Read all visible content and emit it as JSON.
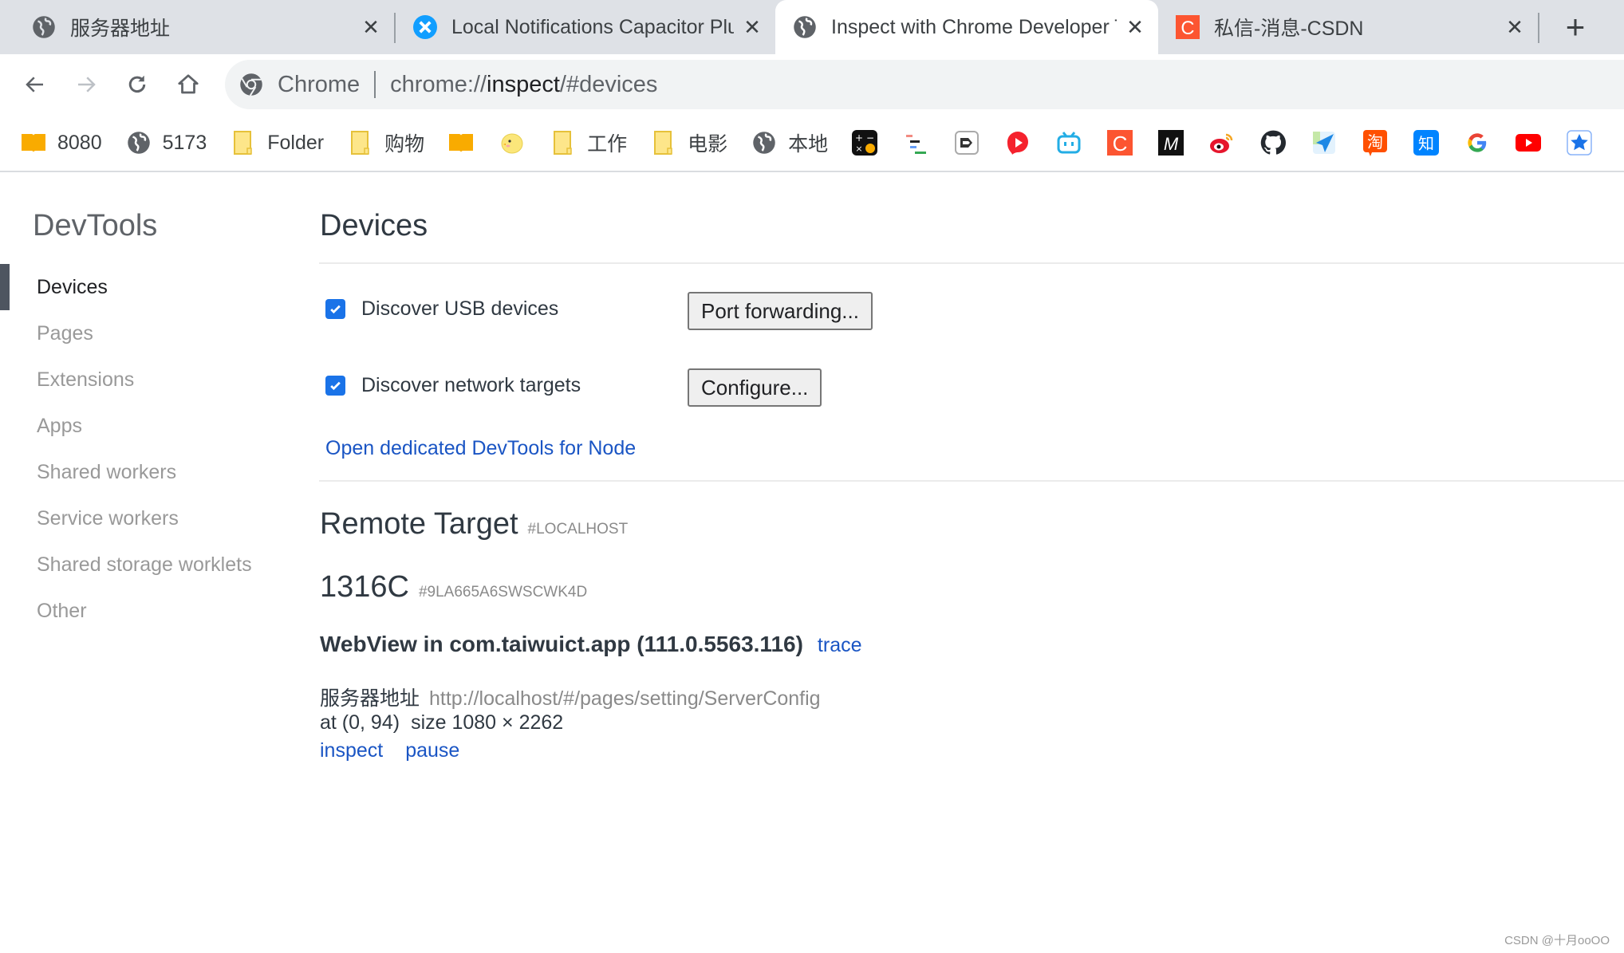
{
  "browser": {
    "tabs": [
      {
        "title": "服务器地址",
        "icon": "globe-icon",
        "active": false
      },
      {
        "title": "Local Notifications Capacitor Plugin API",
        "icon": "capacitor-icon",
        "active": false
      },
      {
        "title": "Inspect with Chrome Developer Tools",
        "icon": "globe-icon",
        "active": true
      },
      {
        "title": "私信-消息-CSDN",
        "icon": "csdn-icon",
        "active": false
      }
    ],
    "new_tab_label": "+",
    "close_label": "✕",
    "omnibox": {
      "chip": "Chrome",
      "url_prefix": "chrome://",
      "url_host": "inspect",
      "url_suffix": "/#devices"
    },
    "bookmarks": [
      {
        "label": "8080",
        "icon": "book-icon"
      },
      {
        "label": "5173",
        "icon": "globe-icon"
      },
      {
        "label": "Folder",
        "icon": "folder-icon"
      },
      {
        "label": "购物",
        "icon": "folder-icon"
      },
      {
        "label": "",
        "icon": "book-icon"
      },
      {
        "label": "",
        "icon": "chick-icon"
      },
      {
        "label": "工作",
        "icon": "folder-icon"
      },
      {
        "label": "电影",
        "icon": "folder-icon"
      },
      {
        "label": "本地",
        "icon": "globe-icon"
      },
      {
        "label": "",
        "icon": "calculator-icon"
      },
      {
        "label": "",
        "icon": "list-icon"
      },
      {
        "label": "",
        "icon": "arrow-box-icon"
      },
      {
        "label": "",
        "icon": "red-play-icon"
      },
      {
        "label": "",
        "icon": "bilibili-icon"
      },
      {
        "label": "",
        "icon": "csdn-icon"
      },
      {
        "label": "",
        "icon": "m-icon"
      },
      {
        "label": "",
        "icon": "weibo-icon"
      },
      {
        "label": "",
        "icon": "github-icon"
      },
      {
        "label": "",
        "icon": "paper-plane-icon"
      },
      {
        "label": "",
        "icon": "taobao-icon"
      },
      {
        "label": "",
        "icon": "zhihu-icon"
      },
      {
        "label": "",
        "icon": "google-icon"
      },
      {
        "label": "",
        "icon": "youtube-icon"
      },
      {
        "label": "",
        "icon": "star-icon"
      }
    ]
  },
  "sidebar": {
    "title": "DevTools",
    "items": [
      {
        "label": "Devices",
        "selected": true
      },
      {
        "label": "Pages"
      },
      {
        "label": "Extensions"
      },
      {
        "label": "Apps"
      },
      {
        "label": "Shared workers"
      },
      {
        "label": "Service workers"
      },
      {
        "label": "Shared storage worklets"
      },
      {
        "label": "Other"
      }
    ]
  },
  "devices": {
    "title": "Devices",
    "usb": {
      "label": "Discover USB devices",
      "checked": true,
      "button": "Port forwarding..."
    },
    "network": {
      "label": "Discover network targets",
      "checked": true,
      "button": "Configure..."
    },
    "node_link": "Open dedicated DevTools for Node"
  },
  "remote": {
    "title": "Remote Target",
    "host": "#LOCALHOST",
    "device_name": "1316C",
    "device_serial": "#9LA665A6SWSCWK4D",
    "browser": "WebView in com.taiwuict.app (111.0.5563.116)",
    "trace": "trace",
    "page": {
      "title": "服务器地址",
      "url": "http://localhost/#/pages/setting/ServerConfig",
      "position": "at (0, 94)",
      "size": "size 1080 × 2262",
      "actions": [
        "inspect",
        "pause"
      ]
    }
  },
  "watermark": "CSDN @十月ooOO"
}
